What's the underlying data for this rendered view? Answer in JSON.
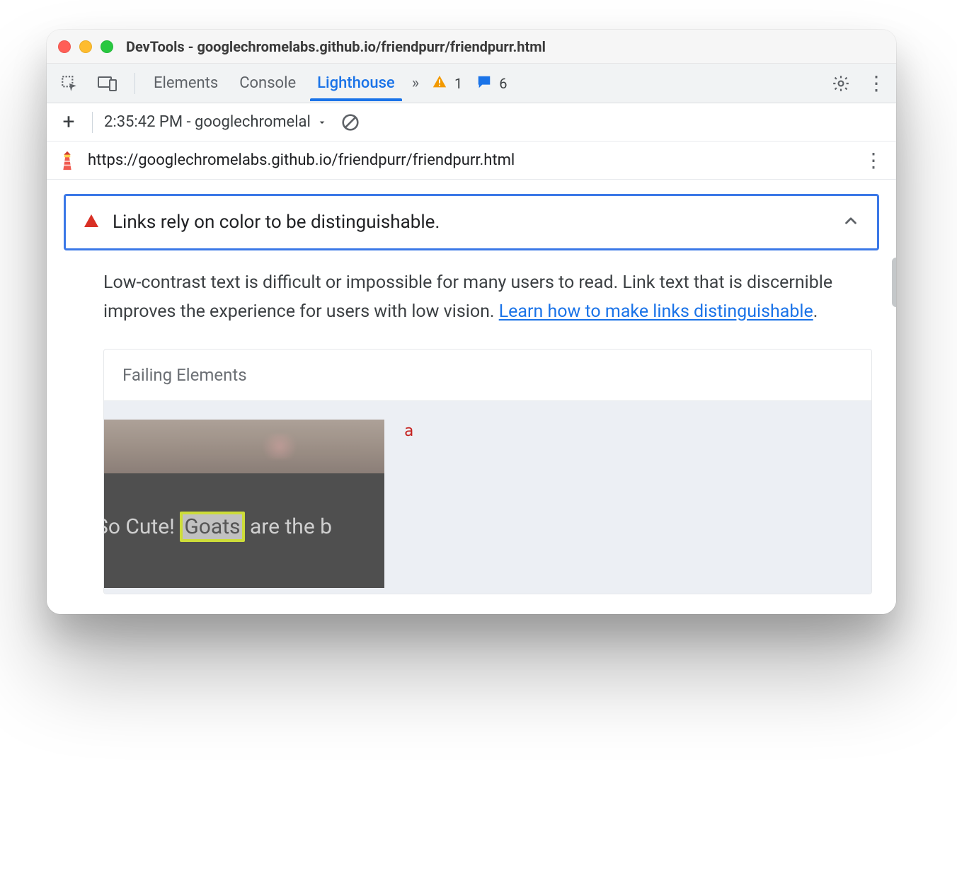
{
  "window": {
    "title": "DevTools - googlechromelabs.github.io/friendpurr/friendpurr.html"
  },
  "devtools": {
    "tabs": {
      "elements": "Elements",
      "console": "Console",
      "lighthouse": "Lighthouse"
    },
    "warnings_count": "1",
    "issues_count": "6"
  },
  "report_selector": {
    "label": "2:35:42 PM - googlechromelal"
  },
  "report_url": "https://googlechromelabs.github.io/friendpurr/friendpurr.html",
  "audit": {
    "title": "Links rely on color to be distinguishable.",
    "description_pre": "Low-contrast text is difficult or impossible for many users to read. Link text that is discernible improves the experience for users with low vision. ",
    "learn_link": "Learn how to make links distinguishable",
    "period": "."
  },
  "failing": {
    "header": "Failing Elements",
    "snapshot_text_pre": "So Cute! ",
    "snapshot_highlight": "Goats",
    "snapshot_text_post": " are the b",
    "tag": "a"
  }
}
